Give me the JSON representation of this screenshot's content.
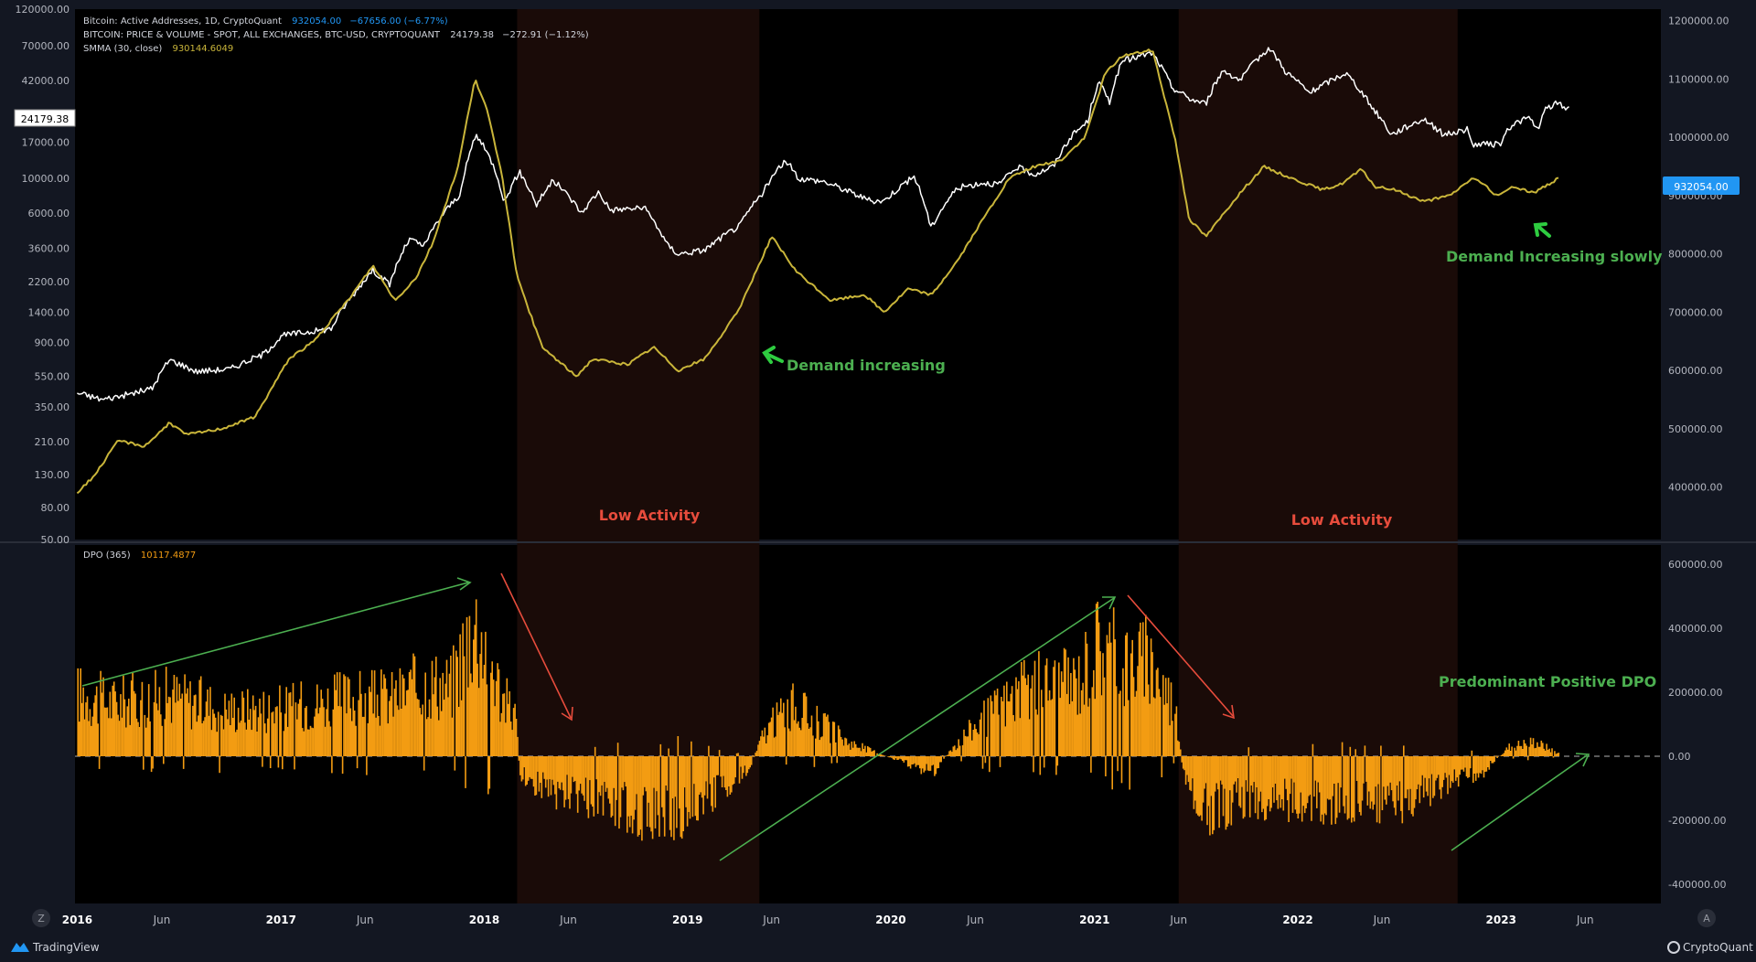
{
  "legend": {
    "line1_name": "Bitcoin: Active Addresses, 1D, CryptoQuant",
    "line1_value": "932054.00",
    "line1_change": "−67656.00 (−6.77%)",
    "line2_name": "BITCOIN: PRICE & VOLUME - SPOT, ALL EXCHANGES, BTC-USD, CRYPTOQUANT",
    "line2_value": "24179.38",
    "line2_change": "−272.91 (−1.12%)",
    "line3_name": "SMMA (30, close)",
    "line3_value": "930144.6049",
    "dpo_name": "DPO (365)",
    "dpo_value": "10117.4877"
  },
  "badges": {
    "price_label": "24179.38",
    "aa_label": "932054.00"
  },
  "annotations": {
    "low_activity_1": "Low Activity",
    "low_activity_2": "Low Activity",
    "demand_increasing": "Demand increasing",
    "demand_increasing_slowly": "Demand Increasing slowly",
    "predominant_positive_dpo": "Predominant Positive DPO"
  },
  "footer": {
    "brand_left": "TradingView",
    "brand_right": "CryptoQuant",
    "left_button": "Z",
    "right_button": "A"
  },
  "colors": {
    "background": "#000000",
    "frame": "#131722",
    "price_line": "#ffffff",
    "active_addresses_smma": "#c9b53a",
    "dpo_histogram": "#f39c12",
    "low_activity_band": "#1a0b08",
    "annotation_red": "#e74c3c",
    "annotation_green": "#4caf50",
    "arrow_bright_green": "#2ecc40",
    "badge_blue": "#2196f3"
  },
  "chart_data": [
    {
      "type": "line",
      "pane": "main",
      "x_axis": {
        "type": "time",
        "range": [
          "2015-12-28",
          "2023-10-15"
        ],
        "ticks": [
          "2016",
          "Jun",
          "2017",
          "Jun",
          "2018",
          "Jun",
          "2019",
          "Jun",
          "2020",
          "Jun",
          "2021",
          "Jun",
          "2022",
          "Jun",
          "2023",
          "Jun"
        ],
        "tick_dates": [
          "2016-01-01",
          "2016-06-01",
          "2017-01-01",
          "2017-06-01",
          "2018-01-01",
          "2018-06-01",
          "2019-01-01",
          "2019-06-01",
          "2020-01-01",
          "2020-06-01",
          "2021-01-01",
          "2021-06-01",
          "2022-01-01",
          "2022-06-01",
          "2023-01-01",
          "2023-06-01"
        ]
      },
      "left_axis": {
        "scale": "log",
        "label_unit": "BTC-USD",
        "range": [
          50,
          120000
        ],
        "ticks": [
          50,
          80,
          130,
          210,
          350,
          550,
          900,
          1400,
          2200,
          3600,
          6000,
          10000,
          17000,
          42000,
          70000,
          120000
        ],
        "tick_labels": [
          "50.00",
          "80.00",
          "130.00",
          "210.00",
          "350.00",
          "550.00",
          "900.00",
          "1400.00",
          "2200.00",
          "3600.00",
          "6000.00",
          "10000.00",
          "17000.00",
          "42000.00",
          "70000.00",
          "120000.00"
        ]
      },
      "right_axis": {
        "scale": "linear",
        "range": [
          310000,
          1220000
        ],
        "ticks": [
          400000,
          500000,
          600000,
          700000,
          800000,
          900000,
          1000000,
          1100000,
          1200000
        ],
        "tick_labels": [
          "400000.00",
          "500000.00",
          "600000.00",
          "700000.00",
          "800000.00",
          "900000.00",
          "1000000.00",
          "1100000.00",
          "1200000.00"
        ]
      },
      "shaded_periods": [
        {
          "start": "2018-03-01",
          "end": "2019-05-10"
        },
        {
          "start": "2021-06-01",
          "end": "2022-10-15"
        }
      ],
      "series": [
        {
          "name": "BITCOIN: PRICE & VOLUME - SPOT, ALL EXCHANGES, BTC-USD, CRYPTOQUANT",
          "axis": "left",
          "color": "#ffffff",
          "points": [
            [
              "2016-01-01",
              430
            ],
            [
              "2016-02-15",
              390
            ],
            [
              "2016-04-01",
              420
            ],
            [
              "2016-05-15",
              460
            ],
            [
              "2016-06-15",
              700
            ],
            [
              "2016-08-01",
              590
            ],
            [
              "2016-10-01",
              610
            ],
            [
              "2016-12-01",
              760
            ],
            [
              "2017-01-05",
              1000
            ],
            [
              "2017-02-15",
              1050
            ],
            [
              "2017-04-01",
              1100
            ],
            [
              "2017-05-15",
              1900
            ],
            [
              "2017-06-15",
              2600
            ],
            [
              "2017-07-15",
              2100
            ],
            [
              "2017-08-20",
              4100
            ],
            [
              "2017-09-15",
              3700
            ],
            [
              "2017-10-20",
              6000
            ],
            [
              "2017-11-20",
              8000
            ],
            [
              "2017-12-17",
              19000
            ],
            [
              "2018-01-20",
              11500
            ],
            [
              "2018-02-06",
              7000
            ],
            [
              "2018-03-05",
              11000
            ],
            [
              "2018-04-05",
              6800
            ],
            [
              "2018-05-05",
              9700
            ],
            [
              "2018-06-25",
              6000
            ],
            [
              "2018-07-25",
              8200
            ],
            [
              "2018-08-15",
              6300
            ],
            [
              "2018-10-15",
              6500
            ],
            [
              "2018-11-25",
              3800
            ],
            [
              "2018-12-15",
              3300
            ],
            [
              "2019-02-01",
              3500
            ],
            [
              "2019-04-05",
              5000
            ],
            [
              "2019-05-15",
              8000
            ],
            [
              "2019-06-26",
              13000
            ],
            [
              "2019-07-20",
              10000
            ],
            [
              "2019-09-01",
              9600
            ],
            [
              "2019-10-20",
              8200
            ],
            [
              "2019-11-25",
              7200
            ],
            [
              "2019-12-20",
              7200
            ],
            [
              "2020-02-12",
              10300
            ],
            [
              "2020-03-13",
              4800
            ],
            [
              "2020-04-30",
              8700
            ],
            [
              "2020-06-15",
              9400
            ],
            [
              "2020-07-15",
              9200
            ],
            [
              "2020-08-15",
              11800
            ],
            [
              "2020-09-15",
              10600
            ],
            [
              "2020-10-20",
              12000
            ],
            [
              "2020-11-20",
              18500
            ],
            [
              "2020-12-20",
              23000
            ],
            [
              "2021-01-08",
              41000
            ],
            [
              "2021-01-28",
              31000
            ],
            [
              "2021-02-20",
              56000
            ],
            [
              "2021-04-14",
              63000
            ],
            [
              "2021-05-20",
              38000
            ],
            [
              "2021-06-22",
              32000
            ],
            [
              "2021-07-20",
              30000
            ],
            [
              "2021-08-20",
              49000
            ],
            [
              "2021-09-20",
              42000
            ],
            [
              "2021-11-10",
              68000
            ],
            [
              "2021-12-10",
              48000
            ],
            [
              "2022-01-22",
              35000
            ],
            [
              "2022-03-28",
              47000
            ],
            [
              "2022-05-12",
              29000
            ],
            [
              "2022-06-18",
              19000
            ],
            [
              "2022-08-15",
              24000
            ],
            [
              "2022-09-20",
              19000
            ],
            [
              "2022-11-01",
              20500
            ],
            [
              "2022-11-10",
              16500
            ],
            [
              "2022-12-30",
              16500
            ],
            [
              "2023-01-20",
              22000
            ],
            [
              "2023-02-20",
              24500
            ],
            [
              "2023-03-10",
              20000
            ],
            [
              "2023-03-20",
              27500
            ],
            [
              "2023-04-14",
              30500
            ],
            [
              "2023-04-25",
              28000
            ],
            [
              "2023-05-05",
              29000
            ]
          ]
        },
        {
          "name": "SMMA (30, close)",
          "axis": "right",
          "color": "#c9b53a",
          "points": [
            [
              "2016-01-01",
              390000
            ],
            [
              "2016-02-01",
              420000
            ],
            [
              "2016-03-15",
              480000
            ],
            [
              "2016-05-01",
              470000
            ],
            [
              "2016-06-15",
              510000
            ],
            [
              "2016-07-15",
              490000
            ],
            [
              "2016-09-15",
              500000
            ],
            [
              "2016-11-15",
              520000
            ],
            [
              "2017-01-15",
              620000
            ],
            [
              "2017-03-01",
              650000
            ],
            [
              "2017-05-01",
              720000
            ],
            [
              "2017-06-15",
              780000
            ],
            [
              "2017-07-25",
              720000
            ],
            [
              "2017-09-01",
              760000
            ],
            [
              "2017-10-01",
              820000
            ],
            [
              "2017-11-15",
              950000
            ],
            [
              "2017-12-15",
              1100000
            ],
            [
              "2018-01-05",
              1050000
            ],
            [
              "2018-02-01",
              940000
            ],
            [
              "2018-03-01",
              760000
            ],
            [
              "2018-04-15",
              640000
            ],
            [
              "2018-06-15",
              590000
            ],
            [
              "2018-07-15",
              620000
            ],
            [
              "2018-09-15",
              610000
            ],
            [
              "2018-11-01",
              640000
            ],
            [
              "2018-12-15",
              600000
            ],
            [
              "2019-02-01",
              620000
            ],
            [
              "2019-04-01",
              700000
            ],
            [
              "2019-06-01",
              830000
            ],
            [
              "2019-07-15",
              770000
            ],
            [
              "2019-09-15",
              720000
            ],
            [
              "2019-11-15",
              730000
            ],
            [
              "2019-12-20",
              700000
            ],
            [
              "2020-02-01",
              740000
            ],
            [
              "2020-03-15",
              730000
            ],
            [
              "2020-05-01",
              790000
            ],
            [
              "2020-06-15",
              860000
            ],
            [
              "2020-08-01",
              930000
            ],
            [
              "2020-09-15",
              950000
            ],
            [
              "2020-11-01",
              960000
            ],
            [
              "2020-12-15",
              1000000
            ],
            [
              "2021-01-20",
              1110000
            ],
            [
              "2021-02-20",
              1140000
            ],
            [
              "2021-04-15",
              1150000
            ],
            [
              "2021-05-25",
              1000000
            ],
            [
              "2021-06-20",
              860000
            ],
            [
              "2021-07-20",
              830000
            ],
            [
              "2021-09-15",
              900000
            ],
            [
              "2021-11-01",
              950000
            ],
            [
              "2021-12-20",
              930000
            ],
            [
              "2022-02-15",
              910000
            ],
            [
              "2022-03-20",
              920000
            ],
            [
              "2022-04-25",
              945000
            ],
            [
              "2022-05-20",
              915000
            ],
            [
              "2022-06-25",
              910000
            ],
            [
              "2022-08-15",
              890000
            ],
            [
              "2022-10-01",
              900000
            ],
            [
              "2022-11-10",
              930000
            ],
            [
              "2022-12-01",
              920000
            ],
            [
              "2022-12-20",
              900000
            ],
            [
              "2023-01-25",
              915000
            ],
            [
              "2023-03-01",
              905000
            ],
            [
              "2023-04-15",
              930144
            ]
          ]
        }
      ]
    },
    {
      "type": "bar",
      "pane": "dpo",
      "name": "DPO (365)",
      "color": "#f39c12",
      "last_value": 10117.4877,
      "y_axis": {
        "range": [
          -460000,
          660000
        ],
        "ticks": [
          -400000,
          -200000,
          0,
          200000,
          400000,
          600000
        ],
        "tick_labels": [
          "-400000.00",
          "-200000.00",
          "0.00",
          "200000.00",
          "400000.00",
          "600000.00"
        ]
      },
      "envelope": [
        [
          "2016-01-01",
          270000
        ],
        [
          "2016-03-01",
          230000
        ],
        [
          "2016-06-15",
          260000
        ],
        [
          "2016-10-01",
          200000
        ],
        [
          "2017-01-15",
          210000
        ],
        [
          "2017-05-01",
          250000
        ],
        [
          "2017-07-15",
          250000
        ],
        [
          "2017-09-20",
          320000
        ],
        [
          "2017-11-01",
          300000
        ],
        [
          "2017-12-10",
          580000
        ],
        [
          "2018-01-05",
          470000
        ],
        [
          "2018-02-01",
          250000
        ],
        [
          "2018-02-25",
          180000
        ],
        [
          "2018-03-05",
          -80000
        ],
        [
          "2018-05-01",
          -150000
        ],
        [
          "2018-08-01",
          -190000
        ],
        [
          "2018-11-01",
          -260000
        ],
        [
          "2018-12-20",
          -240000
        ],
        [
          "2019-03-01",
          -140000
        ],
        [
          "2019-04-20",
          -60000
        ],
        [
          "2019-05-15",
          90000
        ],
        [
          "2019-07-01",
          220000
        ],
        [
          "2019-08-15",
          160000
        ],
        [
          "2019-10-15",
          60000
        ],
        [
          "2019-12-01",
          20000
        ],
        [
          "2020-01-15",
          -20000
        ],
        [
          "2020-03-15",
          -70000
        ],
        [
          "2020-05-01",
          70000
        ],
        [
          "2020-07-15",
          220000
        ],
        [
          "2020-09-15",
          300000
        ],
        [
          "2020-12-01",
          320000
        ],
        [
          "2021-01-05",
          480000
        ],
        [
          "2021-02-15",
          420000
        ],
        [
          "2021-04-15",
          400000
        ],
        [
          "2021-05-25",
          200000
        ],
        [
          "2021-06-10",
          -120000
        ],
        [
          "2021-07-15",
          -240000
        ],
        [
          "2021-10-01",
          -180000
        ],
        [
          "2022-01-01",
          -200000
        ],
        [
          "2022-04-15",
          -190000
        ],
        [
          "2022-07-01",
          -200000
        ],
        [
          "2022-10-01",
          -120000
        ],
        [
          "2022-12-01",
          -60000
        ],
        [
          "2023-01-15",
          40000
        ],
        [
          "2023-03-01",
          60000
        ],
        [
          "2023-04-15",
          10117
        ]
      ]
    }
  ]
}
